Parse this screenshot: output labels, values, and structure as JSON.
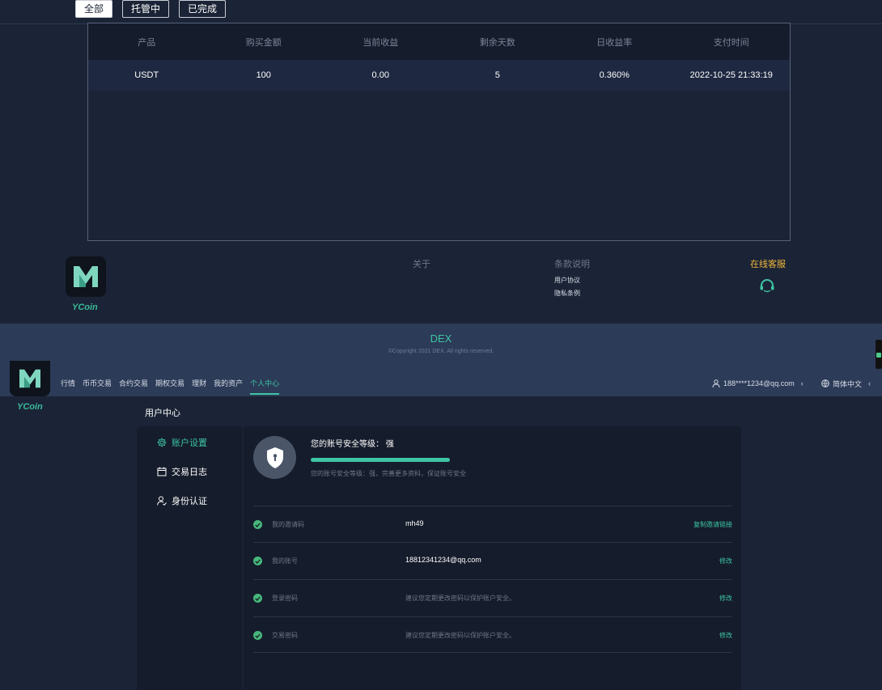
{
  "filters": [
    "全部",
    "托管中",
    "已完成"
  ],
  "table": {
    "headers": [
      "产品",
      "购买金额",
      "当前收益",
      "剩余天数",
      "日收益率",
      "支付时间"
    ],
    "rows": [
      [
        "USDT",
        "100",
        "0.00",
        "5",
        "0.360%",
        "2022-10-25 21:33:19"
      ]
    ]
  },
  "footer": {
    "brand": "YCoin",
    "about": "关于",
    "terms_title": "条款说明",
    "terms_links": [
      "用户协议",
      "隐私条例"
    ],
    "online_service": "在线客服",
    "dex_title": "DEX",
    "copyright": "©Copyright 2021 DEX. All rights reserved."
  },
  "nav": {
    "brand": "YCoin",
    "items": [
      "行情",
      "币币交易",
      "合约交易",
      "期权交易",
      "理财",
      "我的资产",
      "个人中心"
    ],
    "active_index": 6,
    "user": "188****1234@qq.com",
    "language": "简体中文"
  },
  "user_center": {
    "title": "用户中心",
    "menu": [
      "账户设置",
      "交易日志",
      "身份认证"
    ],
    "security_title": "您的账号安全等级：  强",
    "security_level": 1.0,
    "security_desc": "您的账号安全等级：强，完善更多资料，保证账号安全",
    "rows": [
      {
        "label": "我的邀请码",
        "value": "mh49",
        "action": "复制邀请链接",
        "muted": false
      },
      {
        "label": "我的账号",
        "value": "18812341234@qq.com",
        "action": "修改",
        "muted": false
      },
      {
        "label": "登录密码",
        "value": "建议您定期更改密码以保护账户安全。",
        "action": "修改",
        "muted": true
      },
      {
        "label": "交易密码",
        "value": "建议您定期更改密码以保护账户安全。",
        "action": "修改",
        "muted": true
      }
    ]
  },
  "colors": {
    "accent": "#3dc5a4",
    "gold": "#f1b83a",
    "bg": "#1b2436",
    "panel": "#151c2b",
    "band": "#2c3b57"
  }
}
